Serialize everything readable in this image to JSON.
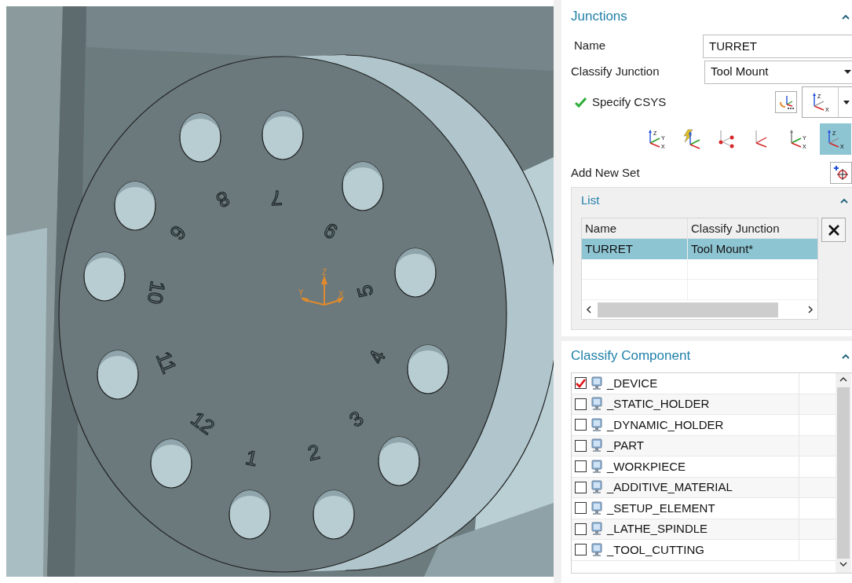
{
  "viewport": {
    "numbers": [
      "1",
      "2",
      "3",
      "4",
      "5",
      "6",
      "7",
      "8",
      "9",
      "10",
      "11",
      "12"
    ],
    "triad": {
      "x": "X",
      "y": "Y",
      "z": "Z"
    }
  },
  "junctions": {
    "title": "Junctions",
    "expanded": true,
    "name": {
      "label": "Name",
      "value": "TURRET"
    },
    "classify": {
      "label": "Classify Junction",
      "value": "Tool Mount"
    },
    "specify_csys": {
      "label": "Specify CSYS",
      "done": true
    },
    "csys_dropdown": {
      "kind": "zx",
      "axis_labels": [
        "Z",
        "X"
      ]
    },
    "csys_types": [
      {
        "kind": "xyz",
        "selected": false,
        "axis_labels": [
          "Z",
          "Y",
          "X"
        ]
      },
      {
        "kind": "dynamic",
        "selected": false
      },
      {
        "kind": "points",
        "selected": false
      },
      {
        "kind": "two-axis",
        "selected": false
      },
      {
        "kind": "xy",
        "selected": false,
        "axis_labels": [
          "Y",
          "X"
        ]
      },
      {
        "kind": "zx",
        "selected": true,
        "axis_labels": [
          "Z",
          "X"
        ]
      }
    ],
    "add_new_set": "Add New Set",
    "list": {
      "title": "List",
      "expanded": true,
      "columns": [
        "Name",
        "Classify Junction"
      ],
      "rows": [
        {
          "cells": [
            "TURRET",
            "Tool Mount*"
          ],
          "selected": true
        }
      ]
    }
  },
  "classify_component": {
    "title": "Classify Component",
    "expanded": true,
    "items": [
      {
        "label": "_DEVICE",
        "checked": true
      },
      {
        "label": "_STATIC_HOLDER",
        "checked": false
      },
      {
        "label": "_DYNAMIC_HOLDER",
        "checked": false
      },
      {
        "label": "_PART",
        "checked": false
      },
      {
        "label": "_WORKPIECE",
        "checked": false
      },
      {
        "label": "_ADDITIVE_MATERIAL",
        "checked": false
      },
      {
        "label": "_SETUP_ELEMENT",
        "checked": false
      },
      {
        "label": "_LATHE_SPINDLE",
        "checked": false
      },
      {
        "label": "_TOOL_CUTTING",
        "checked": false
      }
    ]
  }
}
